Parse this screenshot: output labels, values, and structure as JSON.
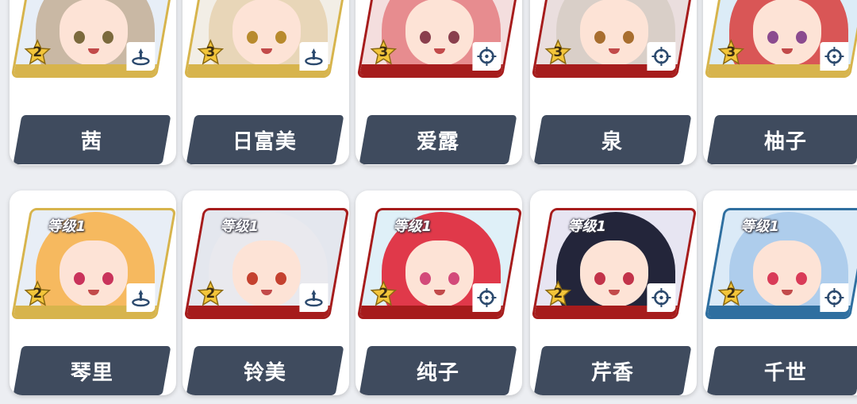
{
  "roster": {
    "row1": [
      {
        "name": "茜",
        "stars": "2",
        "level": "",
        "role": "support",
        "tier": "gold",
        "hair": "#c9b8a4",
        "eye": "#7b6a3d",
        "bg": "#e7eef7"
      },
      {
        "name": "日富美",
        "stars": "3",
        "level": "",
        "role": "support",
        "tier": "gold",
        "hair": "#e8d6b8",
        "eye": "#b88a2d",
        "bg": "#f2eee6"
      },
      {
        "name": "爱露",
        "stars": "3",
        "level": "",
        "role": "attacker",
        "tier": "red",
        "hair": "#e78c8f",
        "eye": "#8a3f4d",
        "bg": "#f4dede"
      },
      {
        "name": "泉",
        "stars": "3",
        "level": "",
        "role": "attacker",
        "tier": "red",
        "hair": "#d9cfc8",
        "eye": "#a86e2f",
        "bg": "#eadede"
      },
      {
        "name": "柚子",
        "stars": "3",
        "level": "",
        "role": "attacker",
        "tier": "gold",
        "hair": "#d95656",
        "eye": "#8b4b8f",
        "bg": "#dcecf7"
      }
    ],
    "row2": [
      {
        "name": "琴里",
        "stars": "2",
        "level": "等级1",
        "role": "support",
        "tier": "gold",
        "hair": "#f6b95f",
        "eye": "#c9335b",
        "bg": "#e8eef6"
      },
      {
        "name": "铃美",
        "stars": "2",
        "level": "等级1",
        "role": "support",
        "tier": "red",
        "hair": "#e9e9ee",
        "eye": "#c4412f",
        "bg": "#e4e7ee"
      },
      {
        "name": "纯子",
        "stars": "2",
        "level": "等级1",
        "role": "attacker",
        "tier": "red",
        "hair": "#e0394a",
        "eye": "#d34a7a",
        "bg": "#dff0f8"
      },
      {
        "name": "芹香",
        "stars": "2",
        "level": "等级1",
        "role": "attacker",
        "tier": "red",
        "hair": "#23253a",
        "eye": "#c2334a",
        "bg": "#e7e5f2"
      },
      {
        "name": "千世",
        "stars": "2",
        "level": "等级1",
        "role": "attacker",
        "tier": "blue",
        "hair": "#aecdec",
        "eye": "#d93b58",
        "bg": "#dbeaf7"
      }
    ]
  },
  "colors": {
    "name_plate": "#3f4b5e",
    "tier_gold": "#d7b44c",
    "tier_red": "#a61c1c",
    "tier_blue": "#2f6fa0",
    "star_fill": "#f3c53a"
  },
  "icons": {
    "support": "support-role-icon",
    "attacker": "crosshair-role-icon",
    "star": "star-icon"
  }
}
